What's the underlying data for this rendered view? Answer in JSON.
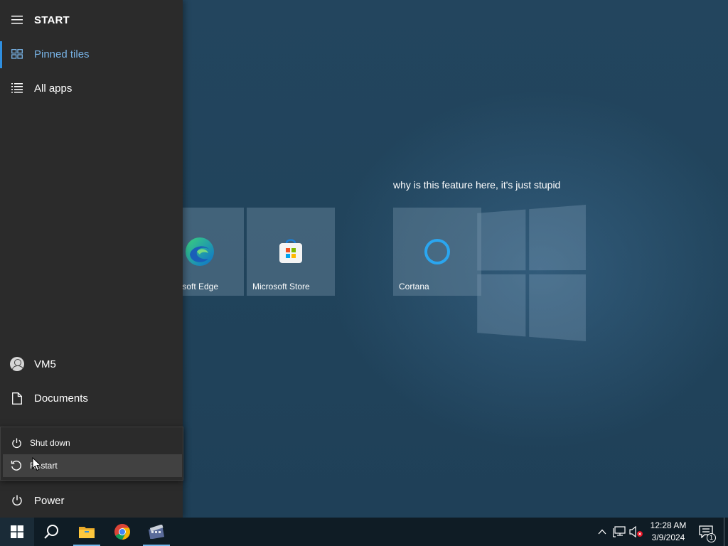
{
  "start_menu": {
    "header_label": "START",
    "pinned_tiles_label": "Pinned tiles",
    "all_apps_label": "All apps",
    "user_label": "VM5",
    "documents_label": "Documents",
    "power_label": "Power",
    "power_flyout": {
      "shutdown_label": "Shut down",
      "restart_label": "Restart",
      "highlighted": "Restart"
    }
  },
  "tiles": {
    "group_title": "why is this feature here, it's just stupid",
    "items": [
      {
        "label": "Microsoft Edge",
        "icon": "edge-icon"
      },
      {
        "label": "Microsoft Store",
        "icon": "store-icon"
      },
      {
        "label": "Cortana",
        "icon": "cortana-icon"
      }
    ]
  },
  "taskbar": {
    "pinned": [
      {
        "name": "start",
        "icon": "windows-icon"
      },
      {
        "name": "search",
        "icon": "search-icon"
      },
      {
        "name": "file-explorer",
        "icon": "folder-icon",
        "running": true
      },
      {
        "name": "chrome",
        "icon": "chrome-icon",
        "running": false
      },
      {
        "name": "video-app",
        "icon": "film-icon",
        "running": true
      }
    ],
    "tray": {
      "time": "12:28 AM",
      "date": "3/9/2024",
      "notification_count": "1"
    }
  },
  "colors": {
    "accent": "#2f8fe0",
    "pinned_text": "#78b3e6",
    "rail_bg": "#2b2b2b",
    "taskbar_bg": "#0f1c25",
    "desktop_bg": "#21445c"
  }
}
